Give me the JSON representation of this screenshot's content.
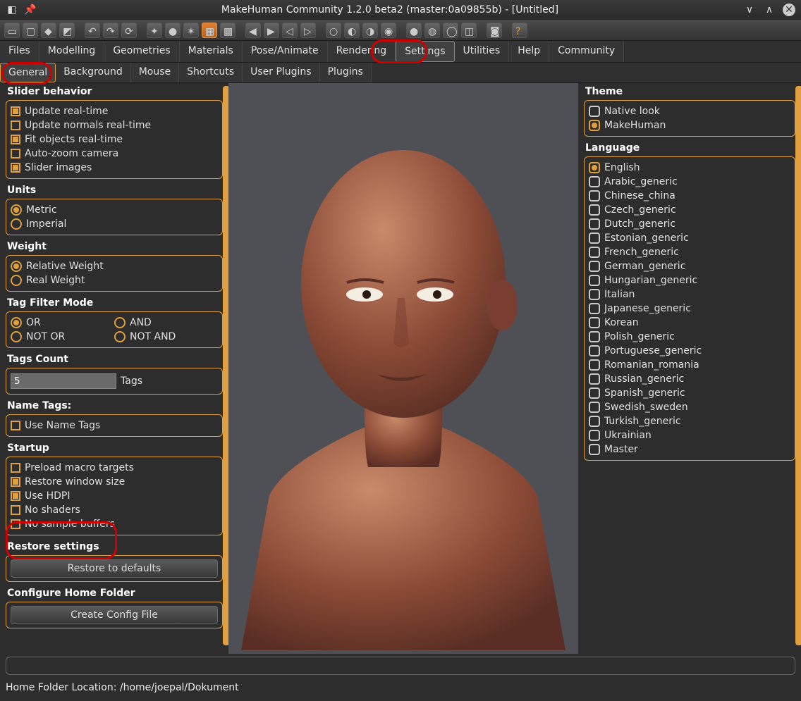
{
  "window": {
    "title": "MakeHuman Community 1.2.0 beta2 (master:0a09855b) - [Untitled]"
  },
  "menubar": [
    "Files",
    "Modelling",
    "Geometries",
    "Materials",
    "Pose/Animate",
    "Rendering",
    "Settings",
    "Utilities",
    "Help",
    "Community"
  ],
  "menubar_active": "Settings",
  "submenubar": [
    "General",
    "Background",
    "Mouse",
    "Shortcuts",
    "User Plugins",
    "Plugins"
  ],
  "submenubar_active": "General",
  "left": {
    "slider_behavior": {
      "title": "Slider behavior",
      "opts": [
        {
          "label": "Update real-time",
          "kind": "chk",
          "checked": true
        },
        {
          "label": "Update normals real-time",
          "kind": "chk",
          "checked": false
        },
        {
          "label": "Fit objects real-time",
          "kind": "chk",
          "checked": true
        },
        {
          "label": "Auto-zoom camera",
          "kind": "chk",
          "checked": false
        },
        {
          "label": "Slider images",
          "kind": "chk",
          "checked": true
        }
      ]
    },
    "units": {
      "title": "Units",
      "opts": [
        {
          "label": "Metric",
          "kind": "radio",
          "checked": true
        },
        {
          "label": "Imperial",
          "kind": "radio",
          "checked": false
        }
      ]
    },
    "weight": {
      "title": "Weight",
      "opts": [
        {
          "label": "Relative Weight",
          "kind": "radio",
          "checked": true
        },
        {
          "label": "Real Weight",
          "kind": "radio",
          "checked": false
        }
      ]
    },
    "tag_filter": {
      "title": "Tag Filter Mode",
      "left": [
        {
          "label": "OR",
          "checked": true
        },
        {
          "label": "NOT OR",
          "checked": false
        }
      ],
      "right": [
        {
          "label": "AND",
          "checked": false
        },
        {
          "label": "NOT AND",
          "checked": false
        }
      ]
    },
    "tags_count": {
      "title": "Tags Count",
      "value": "5",
      "suffix": "Tags"
    },
    "name_tags": {
      "title": "Name Tags:",
      "opt": {
        "label": "Use Name Tags",
        "checked": false
      }
    },
    "startup": {
      "title": "Startup",
      "opts": [
        {
          "label": "Preload macro targets",
          "checked": false
        },
        {
          "label": "Restore window size",
          "checked": true
        },
        {
          "label": "Use HDPI",
          "checked": true
        },
        {
          "label": "No shaders",
          "checked": false
        },
        {
          "label": "No sample buffers",
          "checked": false
        }
      ]
    },
    "restore": {
      "title": "Restore settings",
      "button": "Restore to defaults"
    },
    "config": {
      "title": "Configure Home Folder",
      "button": "Create Config File"
    }
  },
  "right": {
    "theme": {
      "title": "Theme",
      "opts": [
        {
          "label": "Native look",
          "checked": false
        },
        {
          "label": "MakeHuman",
          "checked": true
        }
      ]
    },
    "language": {
      "title": "Language",
      "opts": [
        {
          "label": "English",
          "checked": true
        },
        {
          "label": "Arabic_generic",
          "checked": false
        },
        {
          "label": "Chinese_china",
          "checked": false
        },
        {
          "label": "Czech_generic",
          "checked": false
        },
        {
          "label": "Dutch_generic",
          "checked": false
        },
        {
          "label": "Estonian_generic",
          "checked": false
        },
        {
          "label": "French_generic",
          "checked": false
        },
        {
          "label": "German_generic",
          "checked": false
        },
        {
          "label": "Hungarian_generic",
          "checked": false
        },
        {
          "label": "Italian",
          "checked": false
        },
        {
          "label": "Japanese_generic",
          "checked": false
        },
        {
          "label": "Korean",
          "checked": false
        },
        {
          "label": "Polish_generic",
          "checked": false
        },
        {
          "label": "Portuguese_generic",
          "checked": false
        },
        {
          "label": "Romanian_romania",
          "checked": false
        },
        {
          "label": "Russian_generic",
          "checked": false
        },
        {
          "label": "Spanish_generic",
          "checked": false
        },
        {
          "label": "Swedish_sweden",
          "checked": false
        },
        {
          "label": "Turkish_generic",
          "checked": false
        },
        {
          "label": "Ukrainian",
          "checked": false
        },
        {
          "label": "Master",
          "checked": false
        }
      ]
    }
  },
  "footer": "Home Folder Location: /home/joepal/Dokument",
  "toolbar_icons": [
    "new-icon",
    "open-icon",
    "save-icon",
    "export-icon",
    "_sep",
    "undo-icon",
    "redo-icon",
    "reset-icon",
    "_sep",
    "camera-icon",
    "globe-icon",
    "pose-icon",
    "grid-icon",
    "checker-icon",
    "_sep",
    "symm-l-icon",
    "symm-r-icon",
    "symm-l2-icon",
    "symm-r2-icon",
    "_sep",
    "sphere1-icon",
    "sphere2-icon",
    "sphere3-icon",
    "sphere4-icon",
    "_sep",
    "sphere5-icon",
    "muscle-icon",
    "loop-icon",
    "cube-icon",
    "_sep",
    "cam-icon",
    "_sep",
    "help-icon"
  ]
}
